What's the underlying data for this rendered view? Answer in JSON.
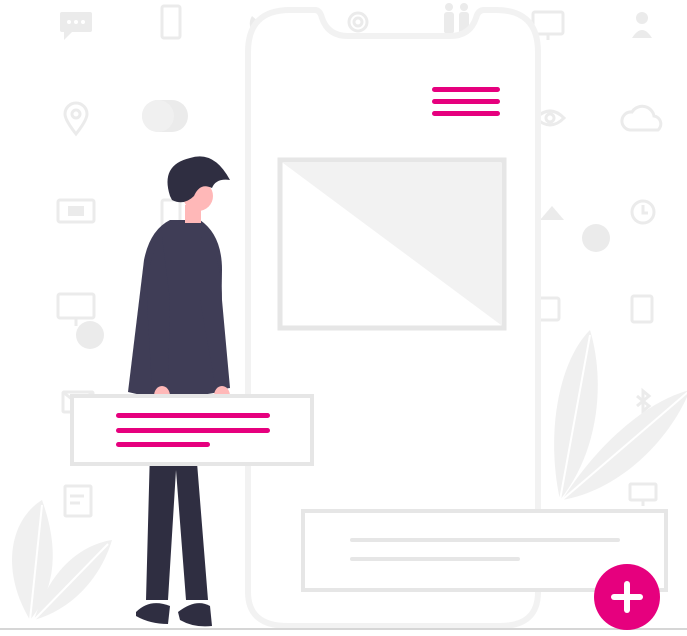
{
  "illustration": {
    "colors": {
      "accent": "#e6007e",
      "person_dark": "#2f2e41",
      "coat": "#3f3d56",
      "skin": "#ffb8b8",
      "phone_outline": "#f2f2f2",
      "card_outline": "#e6e6e6",
      "icon_gray": "#ebebeb",
      "leaf_gray": "#f0f0f0",
      "ground": "#d6d6d6"
    },
    "background_icons": [
      "chat-icon",
      "mobile-icon",
      "phone-icon",
      "at-sign-icon",
      "people-icon",
      "monitor-icon",
      "user-icon",
      "location-pin-icon",
      "toggle-icon",
      "eye-icon",
      "cloud-icon",
      "screen-icon",
      "clock-icon",
      "desktop-icon",
      "tablet-icon",
      "bluetooth-icon",
      "mail-icon",
      "edit-document-icon"
    ],
    "fab_icon": "plus-icon"
  }
}
